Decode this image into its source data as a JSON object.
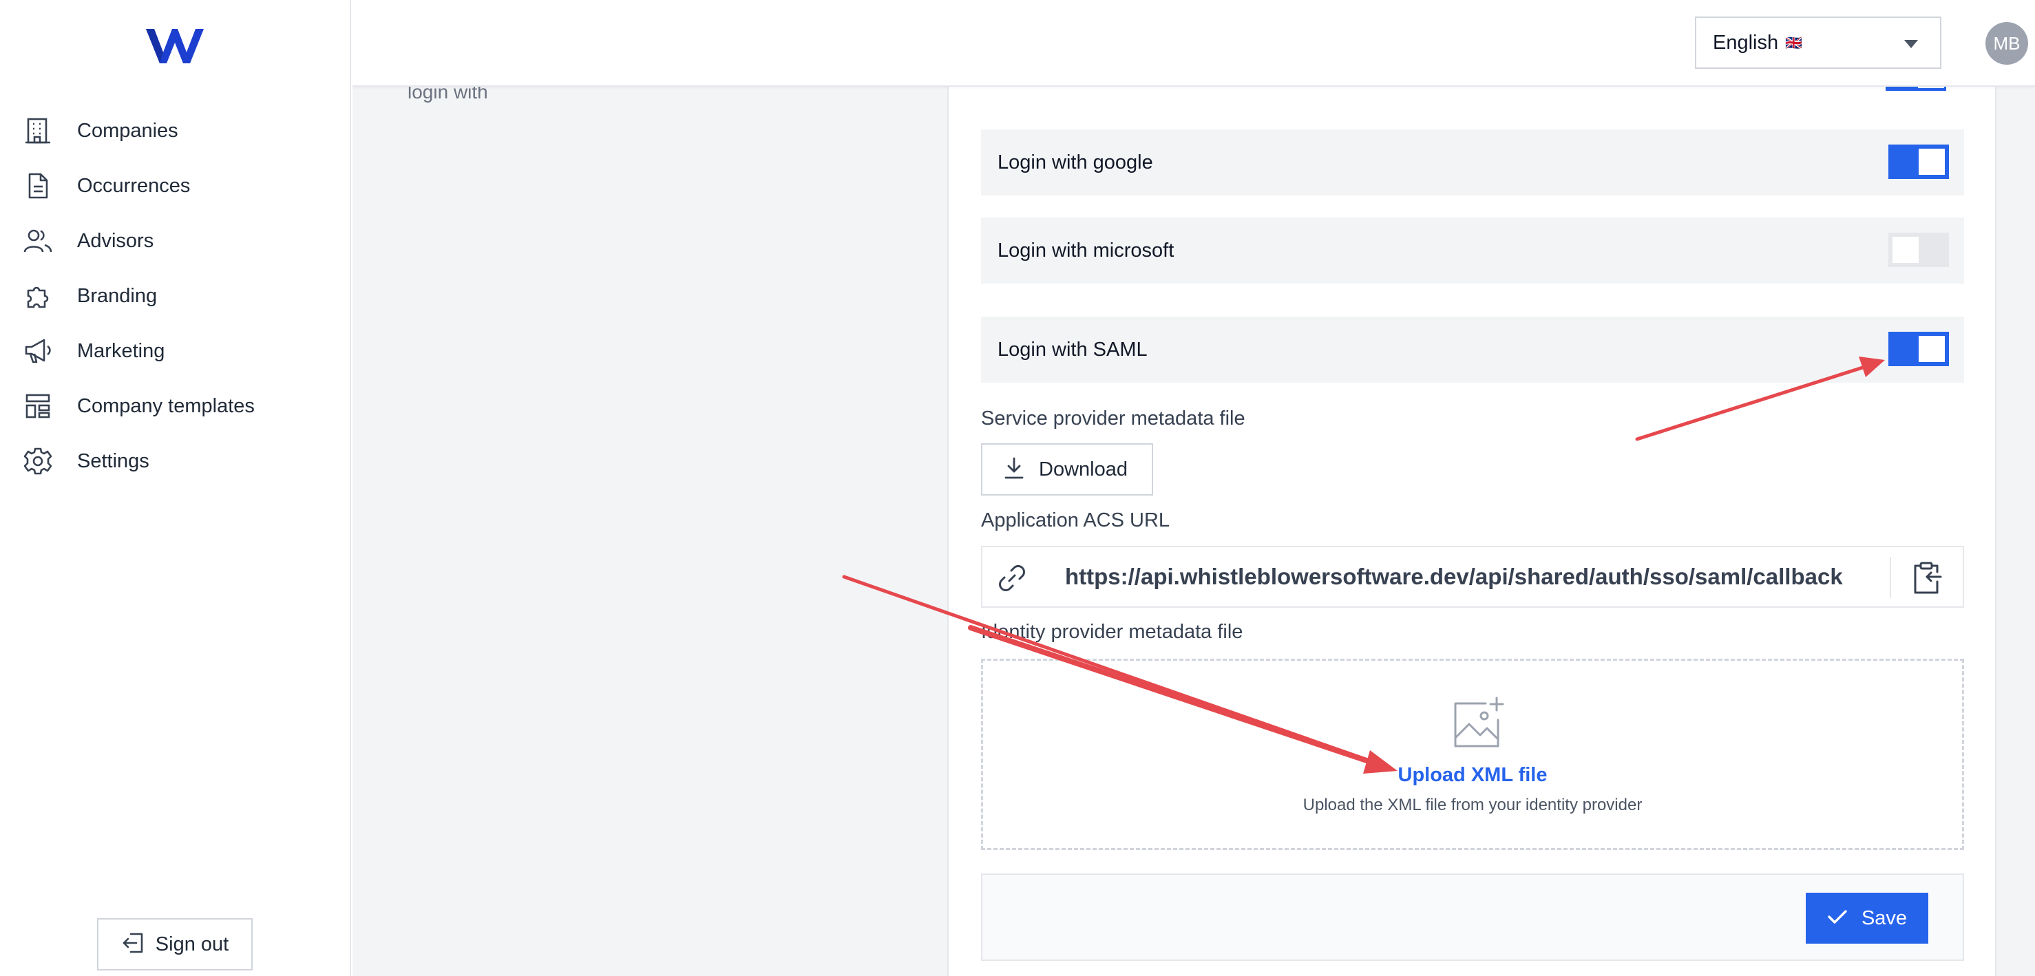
{
  "sidebar": {
    "items": [
      {
        "label": "Companies",
        "icon": "building-icon"
      },
      {
        "label": "Occurrences",
        "icon": "document-icon"
      },
      {
        "label": "Advisors",
        "icon": "users-icon"
      },
      {
        "label": "Branding",
        "icon": "puzzle-icon"
      },
      {
        "label": "Marketing",
        "icon": "megaphone-icon"
      },
      {
        "label": "Company templates",
        "icon": "template-icon"
      },
      {
        "label": "Settings",
        "icon": "gear-icon"
      }
    ],
    "signout_label": "Sign out"
  },
  "header": {
    "language": "English",
    "language_flag": "🇬🇧",
    "avatar_initials": "MB"
  },
  "section": {
    "description_tail": "login with"
  },
  "login_options": [
    {
      "label": "Login with google",
      "enabled": true
    },
    {
      "label": "Login with microsoft",
      "enabled": false
    },
    {
      "label": "Login with SAML",
      "enabled": true
    }
  ],
  "saml": {
    "sp_metadata_label": "Service provider metadata file",
    "download_label": "Download",
    "acs_label": "Application ACS URL",
    "acs_url": "https://api.whistleblowersoftware.dev/api/shared/auth/sso/saml/callback",
    "idp_metadata_label": "Identity provider metadata file",
    "upload_link": "Upload XML file",
    "upload_hint": "Upload the XML file from your identity provider"
  },
  "footer": {
    "save_label": "Save"
  },
  "colors": {
    "accent": "#2563eb",
    "annotation_arrow": "#e5484d"
  }
}
